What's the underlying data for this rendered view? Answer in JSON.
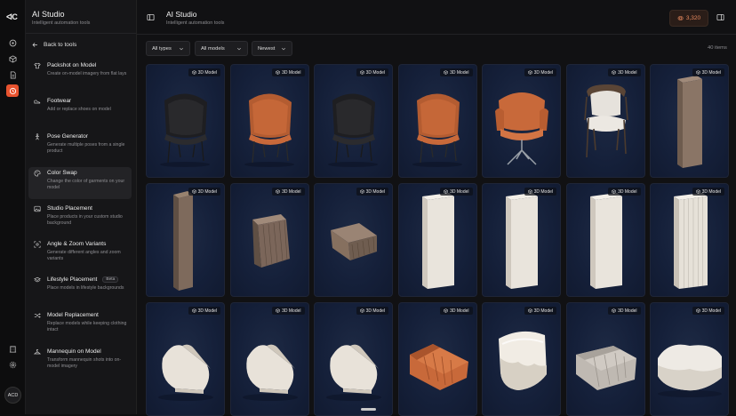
{
  "app": {
    "logo": "ᐊC"
  },
  "sidebar": {
    "title": "AI Studio",
    "subtitle": "Intelligent automation tools",
    "back_label": "Back to tools",
    "tools": [
      {
        "name": "Packshot on Model",
        "desc": "Create on-model imagery from flat lays",
        "icon": "shirt-icon"
      },
      {
        "name": "Footwear",
        "desc": "Add or replace shoes on model",
        "icon": "shoe-icon"
      },
      {
        "name": "Pose Generator",
        "desc": "Generate multiple poses from a single product",
        "icon": "person-icon"
      },
      {
        "name": "Color Swap",
        "desc": "Change the color of garments on your model",
        "icon": "palette-icon",
        "active": true
      },
      {
        "name": "Studio Placement",
        "desc": "Place products in your custom studio background",
        "icon": "image-icon"
      },
      {
        "name": "Angle & Zoom Variants",
        "desc": "Generate different angles and zoom variants",
        "icon": "zoom-icon"
      },
      {
        "name": "Lifestyle Placement",
        "desc": "Place models in lifestyle backgrounds",
        "icon": "layers-icon",
        "badge": "Beta"
      },
      {
        "name": "Model Replacement",
        "desc": "Replace models while keeping clothing intact",
        "icon": "shuffle-icon"
      },
      {
        "name": "Mannequin on Model",
        "desc": "Transform mannequin shots into on-model imagery",
        "icon": "hanger-icon"
      }
    ]
  },
  "rail": {
    "avatar": "ACD"
  },
  "header": {
    "title": "AI Studio",
    "subtitle": "Intelligent automation tools",
    "credits": "3,320"
  },
  "filters": {
    "type": "All types",
    "models": "All models",
    "sort": "Newest",
    "count": "40 items"
  },
  "grid": {
    "tag_label": "3D Model",
    "items": [
      {
        "kind": "chair-black"
      },
      {
        "kind": "chair-orange"
      },
      {
        "kind": "chair-black"
      },
      {
        "kind": "chair-orange"
      },
      {
        "kind": "chair-swivel"
      },
      {
        "kind": "chair-dining"
      },
      {
        "kind": "panel-wood"
      },
      {
        "kind": "panel-wood-tall"
      },
      {
        "kind": "block-wood"
      },
      {
        "kind": "block-wood-small"
      },
      {
        "kind": "panel-white"
      },
      {
        "kind": "panel-white"
      },
      {
        "kind": "panel-white"
      },
      {
        "kind": "panel-white-ribbed"
      },
      {
        "kind": "sofa-white"
      },
      {
        "kind": "sofa-white"
      },
      {
        "kind": "sofa-white"
      },
      {
        "kind": "sofa-orange"
      },
      {
        "kind": "chair-white-round"
      },
      {
        "kind": "sofa-grey"
      },
      {
        "kind": "sofa-white-wide"
      }
    ]
  },
  "colors": {
    "accent": "#e8532f",
    "card_bg": "#15203a",
    "wood": "#8a7566",
    "leather_orange": "#c8693a"
  }
}
